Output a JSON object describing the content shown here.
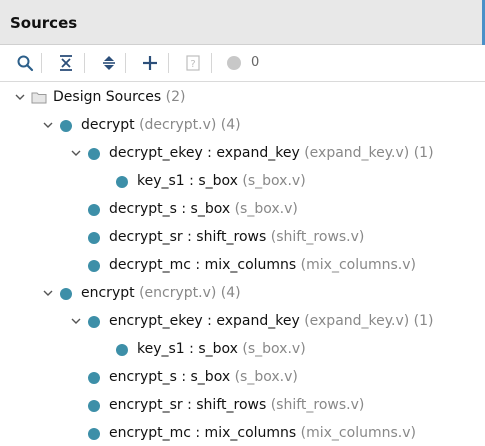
{
  "header": {
    "title": "Sources"
  },
  "toolbar": {
    "buttons": [
      {
        "icon": "search-icon"
      },
      {
        "icon": "collapse-all-icon"
      },
      {
        "icon": "expand-all-icon"
      },
      {
        "icon": "add-icon"
      },
      {
        "icon": "unknown-file-icon"
      }
    ],
    "status_count": "0"
  },
  "colors": {
    "accent": "#4a90c8",
    "node": "#3d8fa8"
  },
  "tree": [
    {
      "name": "Design Sources",
      "meta": "(2)"
    },
    {
      "name": "decrypt",
      "meta": "(decrypt.v) (4)"
    },
    {
      "name": "decrypt_ekey : expand_key",
      "meta": "(expand_key.v) (1)"
    },
    {
      "name": "key_s1 : s_box",
      "meta": "(s_box.v)"
    },
    {
      "name": "decrypt_s : s_box",
      "meta": "(s_box.v)"
    },
    {
      "name": "decrypt_sr : shift_rows",
      "meta": "(shift_rows.v)"
    },
    {
      "name": "decrypt_mc : mix_columns",
      "meta": "(mix_columns.v)"
    },
    {
      "name": "encrypt",
      "meta": "(encrypt.v) (4)"
    },
    {
      "name": "encrypt_ekey : expand_key",
      "meta": "(expand_key.v) (1)"
    },
    {
      "name": "key_s1 : s_box",
      "meta": "(s_box.v)"
    },
    {
      "name": "encrypt_s : s_box",
      "meta": "(s_box.v)"
    },
    {
      "name": "encrypt_sr : shift_rows",
      "meta": "(shift_rows.v)"
    },
    {
      "name": "encrypt_mc : mix_columns",
      "meta": "(mix_columns.v)"
    }
  ]
}
